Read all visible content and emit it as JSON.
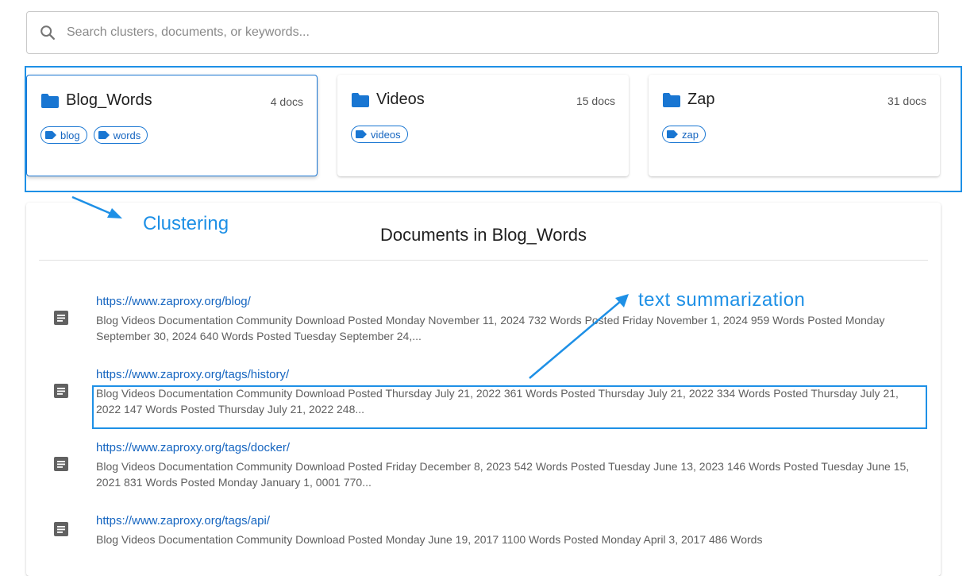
{
  "search": {
    "placeholder": "Search clusters, documents, or keywords..."
  },
  "clusters": [
    {
      "name": "Blog_Words",
      "count": "4 docs",
      "tags": [
        "blog",
        "words"
      ],
      "selected": true
    },
    {
      "name": "Videos",
      "count": "15 docs",
      "tags": [
        "videos"
      ],
      "selected": false
    },
    {
      "name": "Zap",
      "count": "31 docs",
      "tags": [
        "zap"
      ],
      "selected": false
    }
  ],
  "documents": {
    "title": "Documents in Blog_Words",
    "items": [
      {
        "url": "https://www.zaproxy.org/blog/",
        "summary": "Blog Videos Documentation Community Download Posted Monday November 11, 2024 732 Words Posted Friday November 1, 2024 959 Words Posted Monday September 30, 2024 640 Words Posted Tuesday September 24,..."
      },
      {
        "url": "https://www.zaproxy.org/tags/history/",
        "summary": "Blog Videos Documentation Community Download Posted Thursday July 21, 2022 361 Words Posted Thursday July 21, 2022 334 Words Posted Thursday July 21, 2022 147 Words Posted Thursday July 21, 2022 248..."
      },
      {
        "url": "https://www.zaproxy.org/tags/docker/",
        "summary": "Blog Videos Documentation Community Download Posted Friday December 8, 2023 542 Words Posted Tuesday June 13, 2023 146 Words Posted Tuesday June 15, 2021 831 Words Posted Monday January 1, 0001 770..."
      },
      {
        "url": "https://www.zaproxy.org/tags/api/",
        "summary": "Blog Videos Documentation Community Download Posted Monday June 19, 2017 1100 Words Posted Monday April 3, 2017 486 Words"
      }
    ]
  },
  "annotations": {
    "clustering": "Clustering",
    "summarization": "text summarization"
  },
  "colors": {
    "accent": "#1976d2",
    "annotation": "#1e90e6",
    "link": "#1565c0",
    "muted_text": "#5f5f5f"
  },
  "icons": {
    "search": "search-icon",
    "folder": "folder-icon",
    "tag": "tag-icon",
    "document": "document-icon"
  }
}
